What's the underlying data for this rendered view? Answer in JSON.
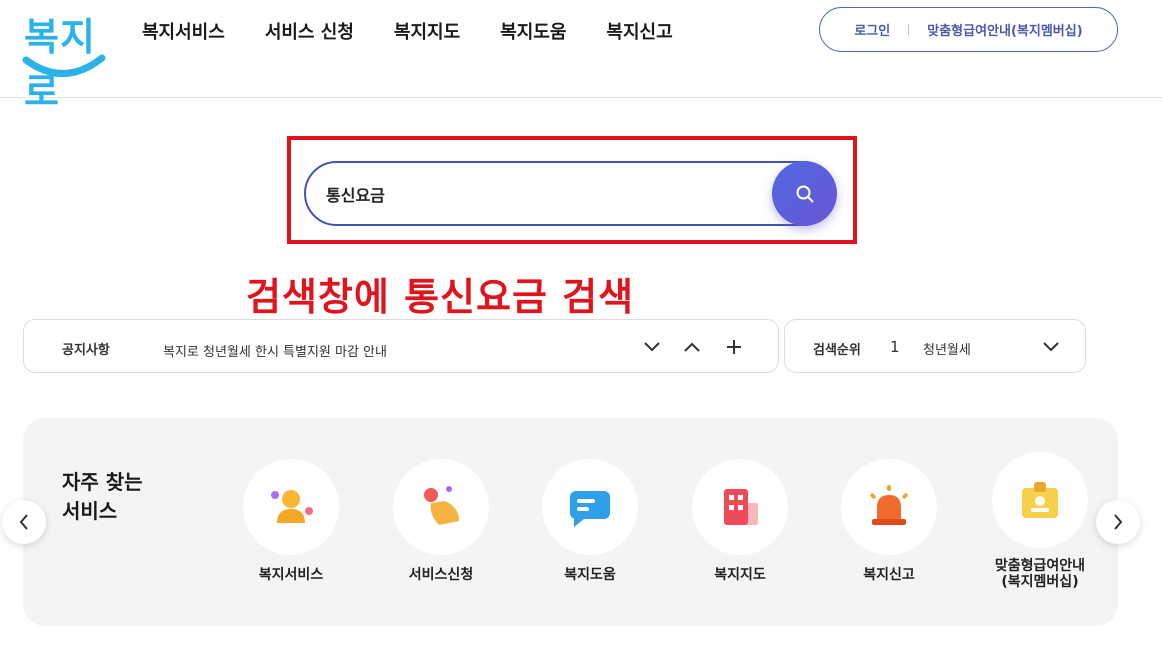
{
  "logo": {
    "text": "복지로"
  },
  "nav": {
    "items": [
      {
        "label": "복지서비스"
      },
      {
        "label": "서비스 신청"
      },
      {
        "label": "복지지도"
      },
      {
        "label": "복지도움"
      },
      {
        "label": "복지신고"
      }
    ]
  },
  "user": {
    "login_label": "로그인",
    "membership_label": "맞춤형급여안내(복지멤버십)"
  },
  "search": {
    "value": "통신요금"
  },
  "annotation": {
    "text": "검색창에 통신요금 검색",
    "color": "#e0141c"
  },
  "notice": {
    "label": "공지사항",
    "text": "복지로 청년월세 한시 특별지원 마감 안내"
  },
  "ranking": {
    "label": "검색순위",
    "rank": "1",
    "text": "청년월세"
  },
  "services": {
    "title": "자주 찾는\n서비스",
    "items": [
      {
        "label": "복지서비스",
        "icon": "person-icon"
      },
      {
        "label": "서비스신청",
        "icon": "hand-tap-icon"
      },
      {
        "label": "복지도움",
        "icon": "chat-icon"
      },
      {
        "label": "복지지도",
        "icon": "building-icon"
      },
      {
        "label": "복지신고",
        "icon": "siren-icon"
      },
      {
        "label": "맞춤형급여안내\n(복지멤버십)",
        "icon": "id-badge-icon"
      }
    ]
  },
  "colors": {
    "brand": "#2bb3e8",
    "accent": "#4f6adf",
    "nav_border": "#5468b8"
  }
}
